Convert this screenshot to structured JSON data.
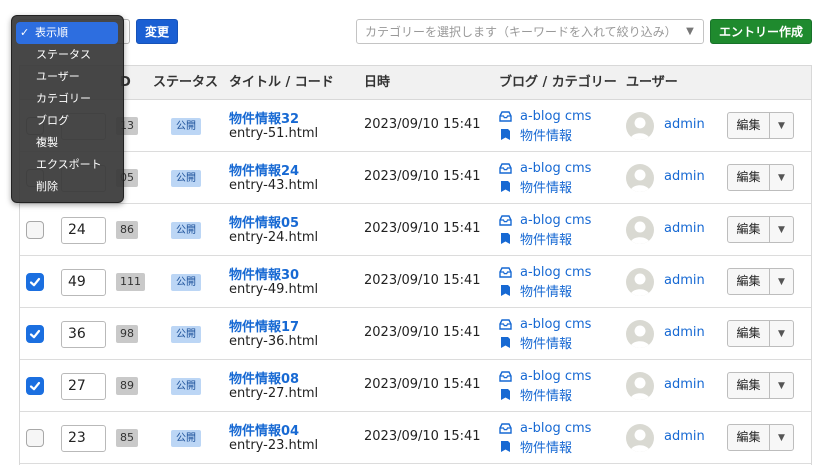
{
  "toolbar": {
    "change_label": "変更",
    "category_placeholder": "カテゴリーを選択します（キーワードを入れて絞り込み）",
    "create_label": "エントリー作成"
  },
  "action_menu": {
    "items": [
      {
        "label": "表示順",
        "selected": true
      },
      {
        "label": "ステータス",
        "selected": false
      },
      {
        "label": "ユーザー",
        "selected": false
      },
      {
        "label": "カテゴリー",
        "selected": false
      },
      {
        "label": "ブログ",
        "selected": false
      },
      {
        "label": "複製",
        "selected": false
      },
      {
        "label": "エクスポート",
        "selected": false
      },
      {
        "label": "削除",
        "selected": false
      }
    ]
  },
  "table": {
    "headers": {
      "id": "D",
      "status": "ステータス",
      "title_code": "タイトル / コード",
      "datetime": "日時",
      "blog_category": "ブログ / カテゴリー",
      "user": "ユーザー"
    },
    "rows": [
      {
        "checked": false,
        "order": "",
        "id": "13",
        "status": "公開",
        "title": "物件情報32",
        "code": "entry-51.html",
        "datetime": "2023/09/10 15:41",
        "blog": "a-blog cms",
        "category": "物件情報",
        "user": "admin",
        "edit": "編集"
      },
      {
        "checked": false,
        "order": "",
        "id": "05",
        "status": "公開",
        "title": "物件情報24",
        "code": "entry-43.html",
        "datetime": "2023/09/10 15:41",
        "blog": "a-blog cms",
        "category": "物件情報",
        "user": "admin",
        "edit": "編集"
      },
      {
        "checked": false,
        "order": "24",
        "id": "86",
        "status": "公開",
        "title": "物件情報05",
        "code": "entry-24.html",
        "datetime": "2023/09/10 15:41",
        "blog": "a-blog cms",
        "category": "物件情報",
        "user": "admin",
        "edit": "編集"
      },
      {
        "checked": true,
        "order": "49",
        "id": "111",
        "status": "公開",
        "title": "物件情報30",
        "code": "entry-49.html",
        "datetime": "2023/09/10 15:41",
        "blog": "a-blog cms",
        "category": "物件情報",
        "user": "admin",
        "edit": "編集"
      },
      {
        "checked": true,
        "order": "36",
        "id": "98",
        "status": "公開",
        "title": "物件情報17",
        "code": "entry-36.html",
        "datetime": "2023/09/10 15:41",
        "blog": "a-blog cms",
        "category": "物件情報",
        "user": "admin",
        "edit": "編集"
      },
      {
        "checked": true,
        "order": "27",
        "id": "89",
        "status": "公開",
        "title": "物件情報08",
        "code": "entry-27.html",
        "datetime": "2023/09/10 15:41",
        "blog": "a-blog cms",
        "category": "物件情報",
        "user": "admin",
        "edit": "編集"
      },
      {
        "checked": false,
        "order": "23",
        "id": "85",
        "status": "公開",
        "title": "物件情報04",
        "code": "entry-23.html",
        "datetime": "2023/09/10 15:41",
        "blog": "a-blog cms",
        "category": "物件情報",
        "user": "admin",
        "edit": "編集"
      }
    ]
  },
  "colors": {
    "primary_button": "#1a5fd3",
    "create_button": "#1f8a2e",
    "link": "#1769d3",
    "checkbox_checked": "#1b6fe0",
    "menu_highlight": "#2d6ee0"
  }
}
